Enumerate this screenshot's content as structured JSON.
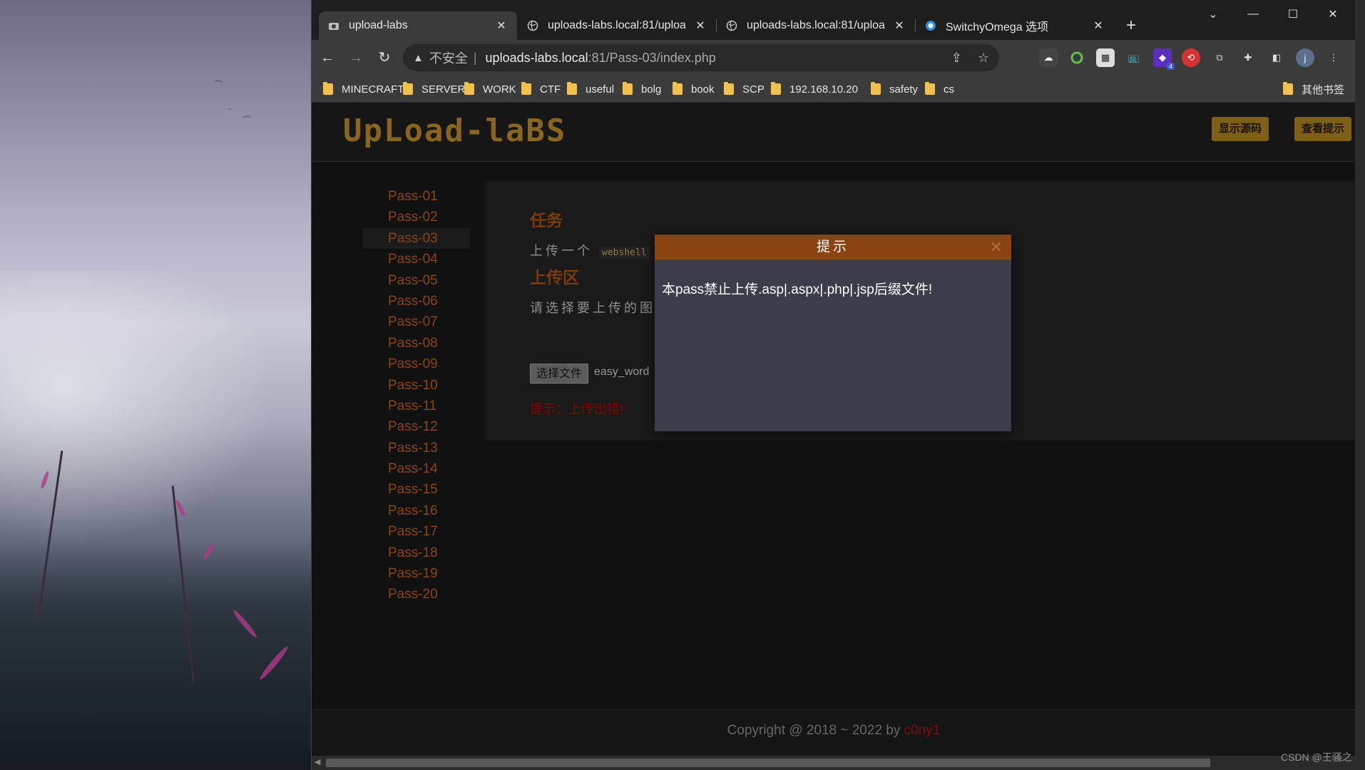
{
  "tabs": [
    {
      "title": "upload-labs",
      "icon": "upload-labs-favicon",
      "active": true
    },
    {
      "title": "uploads-labs.local:81/uploa",
      "icon": "globe-icon",
      "active": false
    },
    {
      "title": "uploads-labs.local:81/uploa",
      "icon": "globe-icon",
      "active": false
    },
    {
      "title": "SwitchyOmega 选项",
      "icon": "switchyomega-icon",
      "active": false
    }
  ],
  "address_bar": {
    "security_label": "不安全",
    "host": "uploads-labs.local",
    "path": ":81/Pass-03/index.php"
  },
  "bookmarks": [
    {
      "label": "MINECRAFT"
    },
    {
      "label": "SERVER"
    },
    {
      "label": "WORK"
    },
    {
      "label": "CTF"
    },
    {
      "label": "useful"
    },
    {
      "label": "bolg"
    },
    {
      "label": "book"
    },
    {
      "label": "SCP"
    },
    {
      "label": "192.168.10.20"
    },
    {
      "label": "safety"
    },
    {
      "label": "cs"
    }
  ],
  "other_bookmarks": "其他书签",
  "extensions": {
    "badge_count": "4",
    "profile_initial": "j"
  },
  "site": {
    "logo": "UpLoad-laBS",
    "show_source_button": "显示源码",
    "view_hint_button": "查看提示"
  },
  "sidebar": {
    "active": "Pass-03",
    "items": [
      "Pass-01",
      "Pass-02",
      "Pass-03",
      "Pass-04",
      "Pass-05",
      "Pass-06",
      "Pass-07",
      "Pass-08",
      "Pass-09",
      "Pass-10",
      "Pass-11",
      "Pass-12",
      "Pass-13",
      "Pass-14",
      "Pass-15",
      "Pass-16",
      "Pass-17",
      "Pass-18",
      "Pass-19",
      "Pass-20"
    ]
  },
  "content": {
    "task_title": "任务",
    "task_text": "上传一个",
    "task_code": "webshell",
    "upload_title": "上传区",
    "upload_text": "请选择要上传的图",
    "choose_file_button": "选择文件",
    "file_name": "easy_word",
    "error_message": "提示：上传出错!"
  },
  "modal": {
    "title": "提示",
    "message": "本pass禁止上传.asp|.aspx|.php|.jsp后缀文件!"
  },
  "footer": {
    "copyright": "Copyright @ 2018 ~ 2022 by ",
    "author": "c0ny1"
  },
  "watermark": "CSDN @王骚之"
}
